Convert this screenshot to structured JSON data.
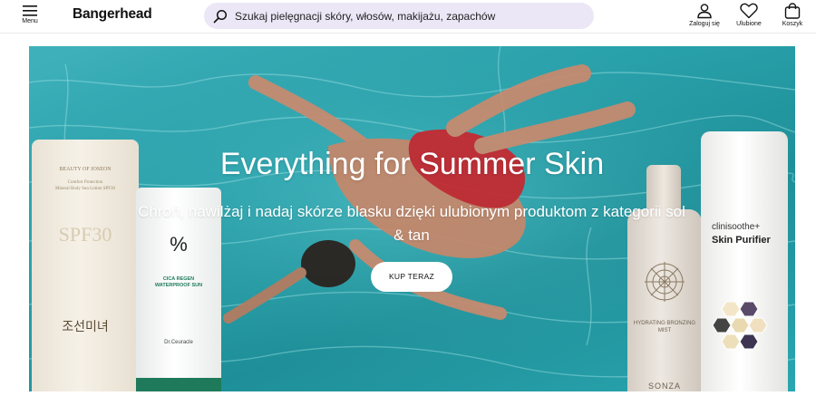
{
  "header": {
    "menu_label": "Menu",
    "logo": "Bangerhead",
    "search_placeholder": "Szukaj pielęgnacji skóry, włosów, makijażu, zapachów",
    "actions": {
      "login": "Zaloguj się",
      "favorites": "Ulubione",
      "cart": "Koszyk"
    }
  },
  "hero": {
    "title": "Everything for Summer Skin",
    "subtitle": "Chroń, nawilżaj i nadaj skórze blasku dzięki ulubionym produktom z kategorii sol & tan",
    "cta_label": "KUP TERAZ"
  },
  "products": {
    "tube1_brand": "BEAUTY OF JOSEON",
    "tube1_spf": "SPF30",
    "tube2_symbol": "%",
    "tube2_name": "CICA REGEN WATERPROOF SUN",
    "tube2_brand": "Dr.Ceuracle",
    "bottle1_name": "HYDRATING BRONZING MIST",
    "bottle1_brand": "SONZA",
    "bottle2_brand": "clinisoothe+",
    "bottle2_name": "Skin Purifier"
  },
  "colors": {
    "search_bg": "#ebe7f6",
    "water": "#2aa3ad",
    "cta_bg": "#ffffff"
  }
}
